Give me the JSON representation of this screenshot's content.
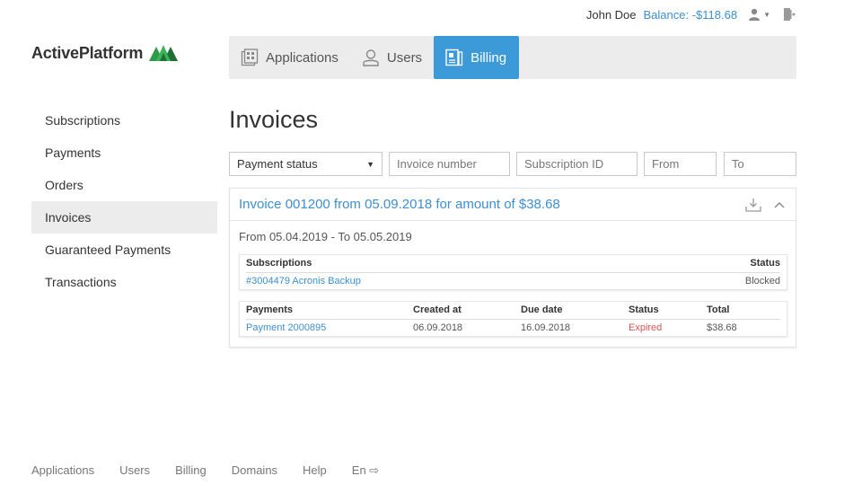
{
  "topbar": {
    "user_name": "John Doe",
    "balance": "Balance: -$118.68"
  },
  "logo": {
    "text": "ActivePlatform",
    "colors": [
      "#2e9b47",
      "#1f6e33"
    ]
  },
  "nav": {
    "tabs": [
      {
        "label": "Applications",
        "icon": "applications-icon"
      },
      {
        "label": "Users",
        "icon": "user-icon"
      },
      {
        "label": "Billing",
        "icon": "billing-icon",
        "active": true
      }
    ]
  },
  "sidebar": {
    "items": [
      {
        "label": "Subscriptions"
      },
      {
        "label": "Payments"
      },
      {
        "label": "Orders"
      },
      {
        "label": "Invoices",
        "active": true
      },
      {
        "label": "Guaranteed Payments"
      },
      {
        "label": "Transactions"
      }
    ]
  },
  "page": {
    "title": "Invoices"
  },
  "filters": {
    "payment_status": "Payment status",
    "invoice_number_placeholder": "Invoice number",
    "subscription_id_placeholder": "Subscription ID",
    "from_placeholder": "From",
    "to_placeholder": "To"
  },
  "invoice": {
    "title": "Invoice 001200 from 05.09.2018 for amount of $38.68",
    "period": "From 05.04.2019 - To 05.05.2019",
    "subscriptions": {
      "headers": {
        "name": "Subscriptions",
        "status": "Status"
      },
      "rows": [
        {
          "name": "#3004479 Acronis Backup",
          "status": "Blocked"
        }
      ]
    },
    "payments": {
      "headers": {
        "name": "Payments",
        "created": "Created at",
        "due": "Due date",
        "status": "Status",
        "total": "Total"
      },
      "rows": [
        {
          "name": "Payment 2000895",
          "created": "06.09.2018",
          "due": "16.09.2018",
          "status": "Expired",
          "total": "$38.68"
        }
      ]
    }
  },
  "footer": {
    "links": [
      {
        "label": "Applications"
      },
      {
        "label": "Users"
      },
      {
        "label": "Billing"
      },
      {
        "label": "Domains"
      },
      {
        "label": "Help"
      },
      {
        "label": "En ⇨"
      }
    ]
  },
  "colors": {
    "accent": "#3d9ad9",
    "link": "#3d8fd1",
    "expired": "#e05353"
  }
}
